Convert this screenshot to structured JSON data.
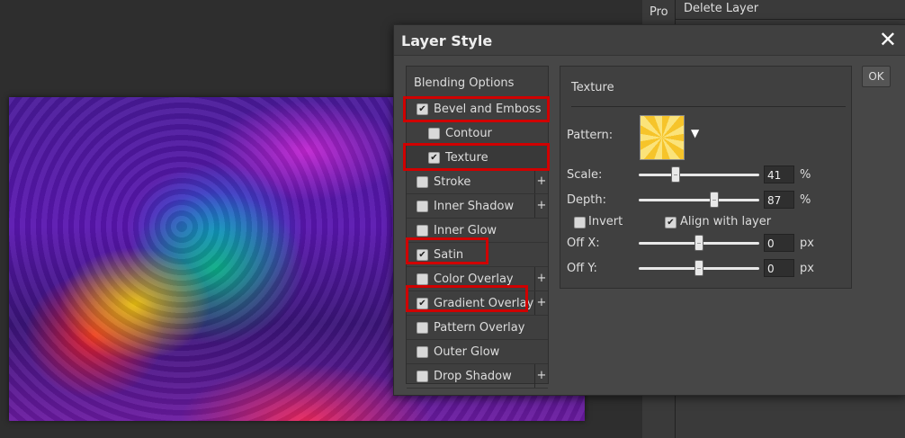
{
  "right_panel": {
    "tab": "Pro",
    "top_item": "Delete Layer"
  },
  "dialog": {
    "title": "Layer Style",
    "close_glyph": "✕",
    "ok_label": "OK"
  },
  "style_list": {
    "header": "Blending Options",
    "items": [
      {
        "label": "Bevel and Emboss",
        "checked": true,
        "sub": false,
        "plus": false
      },
      {
        "label": "Contour",
        "checked": false,
        "sub": true,
        "plus": false
      },
      {
        "label": "Texture",
        "checked": true,
        "sub": true,
        "plus": false
      },
      {
        "label": "Stroke",
        "checked": false,
        "sub": false,
        "plus": true
      },
      {
        "label": "Inner Shadow",
        "checked": false,
        "sub": false,
        "plus": true
      },
      {
        "label": "Inner Glow",
        "checked": false,
        "sub": false,
        "plus": false
      },
      {
        "label": "Satin",
        "checked": true,
        "sub": false,
        "plus": false
      },
      {
        "label": "Color Overlay",
        "checked": false,
        "sub": false,
        "plus": true
      },
      {
        "label": "Gradient Overlay",
        "checked": true,
        "sub": false,
        "plus": true
      },
      {
        "label": "Pattern Overlay",
        "checked": false,
        "sub": false,
        "plus": false
      },
      {
        "label": "Outer Glow",
        "checked": false,
        "sub": false,
        "plus": false
      },
      {
        "label": "Drop Shadow",
        "checked": false,
        "sub": false,
        "plus": true
      }
    ],
    "plus_glyph": "+",
    "check_glyph": "✔"
  },
  "texture": {
    "title": "Texture",
    "pattern_label": "Pattern:",
    "pattern_arrow": "▼",
    "scale_label": "Scale:",
    "scale_value": "41",
    "scale_unit": "%",
    "depth_label": "Depth:",
    "depth_value": "87",
    "depth_unit": "%",
    "invert_label": "Invert",
    "invert_checked": false,
    "align_label": "Align with layer",
    "align_checked": true,
    "offx_label": "Off X:",
    "offx_value": "0",
    "offx_unit": "px",
    "offy_label": "Off Y:",
    "offy_value": "0",
    "offy_unit": "px"
  },
  "colors": {
    "highlight": "#d00000",
    "dialog_bg": "#474747"
  }
}
